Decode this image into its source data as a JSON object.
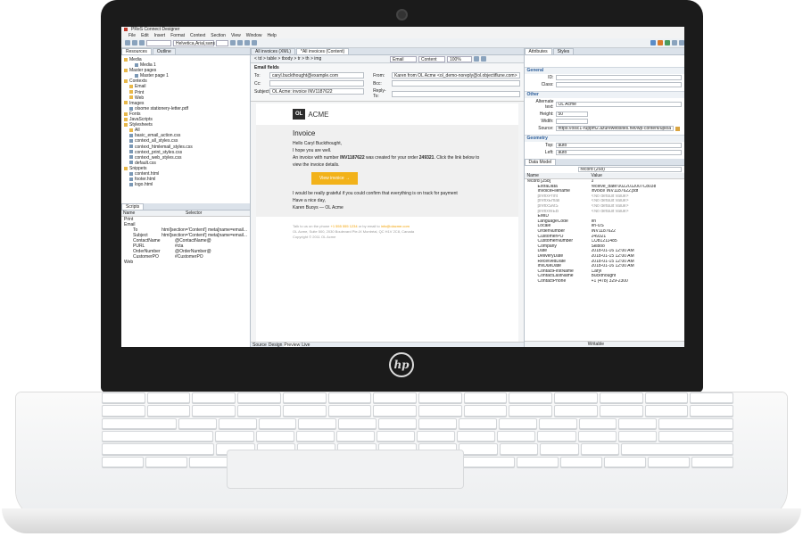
{
  "app": {
    "title": "PReS Connect Designer",
    "menu": [
      "File",
      "Edit",
      "Insert",
      "Format",
      "Context",
      "Section",
      "View",
      "Window",
      "Help"
    ],
    "font_field": "Helvetica,Arial,sans",
    "toolbar_fields": {
      "email": "Email",
      "content": "Content",
      "zoom": "100%"
    },
    "breadcrumb": "< td > table > tbody > tr > th > img"
  },
  "left": {
    "tabs": [
      "Resources",
      "Outline"
    ],
    "tree": [
      {
        "label": "Media",
        "type": "fold",
        "indent": 0
      },
      {
        "label": "Media 1",
        "type": "file",
        "indent": 2
      },
      {
        "label": "Master pages",
        "type": "fold",
        "indent": 0
      },
      {
        "label": "Master page 1",
        "type": "file",
        "indent": 2
      },
      {
        "label": "Contexts",
        "type": "fold",
        "indent": 0
      },
      {
        "label": "Email",
        "type": "fold",
        "indent": 1
      },
      {
        "label": "Print",
        "type": "fold",
        "indent": 1
      },
      {
        "label": "Web",
        "type": "fold",
        "indent": 1
      },
      {
        "label": "Images",
        "type": "fold",
        "indent": 0
      },
      {
        "label": "olsome stationery-letter.pdf",
        "type": "file",
        "indent": 1
      },
      {
        "label": "Fonts",
        "type": "fold",
        "indent": 0
      },
      {
        "label": "JavaScripts",
        "type": "fold",
        "indent": 0
      },
      {
        "label": "Stylesheets",
        "type": "fold",
        "indent": 0
      },
      {
        "label": "All",
        "type": "fold",
        "indent": 1
      },
      {
        "label": "basic_email_action.css",
        "type": "file",
        "indent": 1
      },
      {
        "label": "context_all_styles.css",
        "type": "file",
        "indent": 1
      },
      {
        "label": "context_htmlemail_styles.css",
        "type": "file",
        "indent": 1
      },
      {
        "label": "context_print_styles.css",
        "type": "file",
        "indent": 1
      },
      {
        "label": "context_web_styles.css",
        "type": "file",
        "indent": 1
      },
      {
        "label": "default.css",
        "type": "file",
        "indent": 1
      },
      {
        "label": "Snippets",
        "type": "fold",
        "indent": 0
      },
      {
        "label": "content.html",
        "type": "file",
        "indent": 1
      },
      {
        "label": "footer.html",
        "type": "file",
        "indent": 1
      },
      {
        "label": "logo.html",
        "type": "file",
        "indent": 1
      }
    ],
    "scripts_tab": "Scripts",
    "scripts_cols": [
      "Name",
      "Selector"
    ],
    "scripts": [
      {
        "name": "Print",
        "sel": ""
      },
      {
        "name": "Email",
        "sel": ""
      },
      {
        "name": "To",
        "sel": "html[section='Content'] meta[name=email..."
      },
      {
        "name": "Subject",
        "sel": "html[section='Content'] meta[name=email..."
      },
      {
        "name": "ContactName",
        "sel": "@ContactName@"
      },
      {
        "name": "PURL",
        "sel": "#cta"
      },
      {
        "name": "OrderNumber",
        "sel": "@OrderNumber@"
      },
      {
        "name": "CustomerPO",
        "sel": "#CustomerPO"
      },
      {
        "name": "Web",
        "sel": ""
      }
    ]
  },
  "center": {
    "tabs": [
      "All invoices (XML)",
      "*All invoices (Content)"
    ],
    "email_fields_title": "Email fields",
    "to_label": "To:",
    "to_value": "caryl.buckthought@example.com",
    "cc_label": "Cc:",
    "cc_value": "",
    "subject_label": "Subject:",
    "subject_value": "OL Acme: invoice INV1187622",
    "from_label": "From:",
    "from_value": "Karen from OL Acme <ol_demo-noreply@ol.objectiflune.com>",
    "bcc_label": "Bcc:",
    "bcc_value": "",
    "replyto_label": "Reply-To:",
    "replyto_value": "",
    "brand_ol": "OL",
    "brand_acme": "ACME",
    "invoice_title": "Invoice",
    "greeting": "Hello Caryl Buckthought,",
    "line1": "I hope you are well.",
    "line2_pre": "An invoice with number ",
    "invoice_no": "INV1187622",
    "line2_mid": " was created for your order ",
    "order_no": "249321",
    "line2_post": ". Click the link below to view the invoice details.",
    "cta": "View invoice →",
    "grateful": "I would be really grateful if you could confirm that everything is on track for payment",
    "closing": "Have a nice day,",
    "signature": "Karen Buoys — OL Acme",
    "footer1_pre": "Talk to us on the phone ",
    "footer_phone": "+1 555 555 1234",
    "footer1_mid": " or by email to ",
    "footer_email": "info@olacme.com",
    "footer2": "OL Acme, Suite 500, 2030 Boulevard Pie-IX Montréal, QC H1V 2C8, Canada",
    "footer3": "Copyright © 2011 OL Acme",
    "bottom_tabs": [
      "Source",
      "Design",
      "Preview",
      "Live"
    ]
  },
  "right": {
    "tabs": [
      "Attributes",
      "Styles"
    ],
    "general": "General",
    "id_label": "ID:",
    "class_label": "Class:",
    "other": "Other",
    "alt_label": "Alternate text:",
    "alt_value": "OL Acme",
    "height_label": "Height:",
    "height_value": "50",
    "width_label": "Width:",
    "width_value": "",
    "source_label": "Source:",
    "source_value": "https://olsc1-ruppm2.azurewebsites.net/wp-content/uploa",
    "geometry": "Geometry",
    "top_label": "Top:",
    "top_value": "auto",
    "left_label": "Left:",
    "left_value": "auto",
    "dm_tab": "Data Model",
    "dm_record": "record (258)",
    "dm_cols": [
      "Name",
      "Value"
    ],
    "dm_rows": [
      {
        "n": "record [258]",
        "v": "0"
      },
      {
        "n": "ExtraData",
        "v": "receive_date:00Z2012007C8038"
      },
      {
        "n": "InvoiceFilename",
        "v": "invoice INV1187622.pdf"
      },
      {
        "n": "prefixPrint",
        "v": "<No default value>"
      },
      {
        "n": "prefixEmail",
        "v": "<No default value>"
      },
      {
        "n": "prefixSMS",
        "v": "<No default value>"
      },
      {
        "n": "prefixWEB",
        "v": "<No default value>"
      },
      {
        "n": "EMID",
        "v": ""
      },
      {
        "n": "LanguageCode",
        "v": "en"
      },
      {
        "n": "Locale",
        "v": "en-US"
      },
      {
        "n": "OrderNumber",
        "v": "INV1187622"
      },
      {
        "n": "CustomerPO",
        "v": "249321"
      },
      {
        "n": "CustomerNumber",
        "v": "CU81211485"
      },
      {
        "n": "Company",
        "v": "Skiboo"
      },
      {
        "n": "Date",
        "v": "2018-01-16 12:00 AM"
      },
      {
        "n": "DeliveryDate",
        "v": "2018-01-15 12:00 AM"
      },
      {
        "n": "ReceivedDate",
        "v": "2018-01-15 12:00 AM"
      },
      {
        "n": "InvDueDate",
        "v": "2018-01-16 12:00 AM"
      },
      {
        "n": "ContactFirstName",
        "v": "Caryl"
      },
      {
        "n": "ContactLastName",
        "v": "Buckthought"
      },
      {
        "n": "ContactPhone",
        "v": "+1 (478) 329-2300"
      }
    ],
    "status": "Writable"
  }
}
